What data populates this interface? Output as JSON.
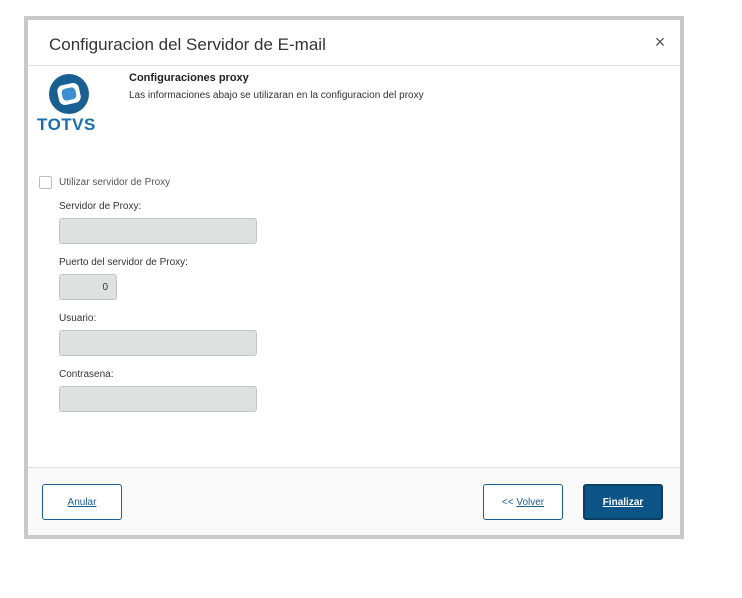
{
  "dialog": {
    "title": "Configuracion del Servidor de E-mail",
    "close_glyph": "×"
  },
  "logo": {
    "text": "TOTVS",
    "icon": "totvs-logo-icon",
    "colors": {
      "outer": "#1a5f91",
      "inner": "#ffffff",
      "core": "#3b8ed0"
    }
  },
  "header": {
    "title": "Configuraciones proxy",
    "subtitle": "Las informaciones abajo se utilizaran en la configuracion del proxy"
  },
  "form": {
    "use_proxy": {
      "label": "Utilizar servidor de Proxy",
      "checked": false
    },
    "proxy_server": {
      "label": "Servidor de Proxy:",
      "value": ""
    },
    "proxy_port": {
      "label": "Puerto del servidor de Proxy:",
      "value": "0"
    },
    "user": {
      "label": "Usuario:",
      "value": ""
    },
    "password": {
      "label": "Contrasena:",
      "value": ""
    }
  },
  "footer": {
    "cancel_label": "Anular",
    "back_prefix": "<< ",
    "back_label": "Volver",
    "finish_label": "Finalizar"
  },
  "colors": {
    "accent": "#0c5485",
    "field_disabled_bg": "#dfe1e1",
    "dialog_border": "#c9c9c9"
  }
}
